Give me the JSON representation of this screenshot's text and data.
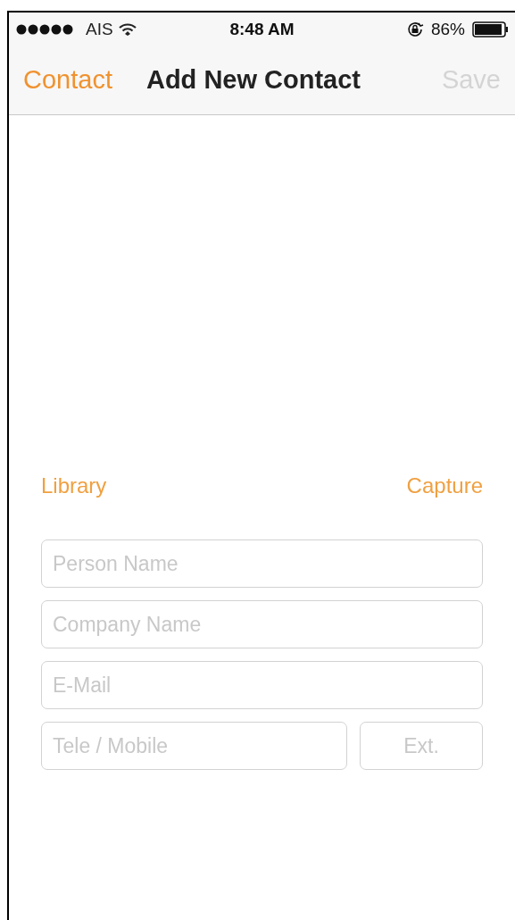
{
  "status_bar": {
    "carrier": "AIS",
    "time": "8:48 AM",
    "battery": "86%"
  },
  "nav_bar": {
    "back": "Contact",
    "title": "Add New Contact",
    "action": {
      "label": "Save",
      "disabled": true
    }
  },
  "photo_actions": [
    "Library",
    "Capture"
  ],
  "fields": [
    {
      "placeholder": "Person Name"
    },
    {
      "placeholder": "Company Name"
    },
    {
      "placeholder": "E-Mail"
    }
  ],
  "phone_row": [
    {
      "placeholder": "Tele / Mobile"
    },
    {
      "placeholder": "Ext."
    }
  ]
}
